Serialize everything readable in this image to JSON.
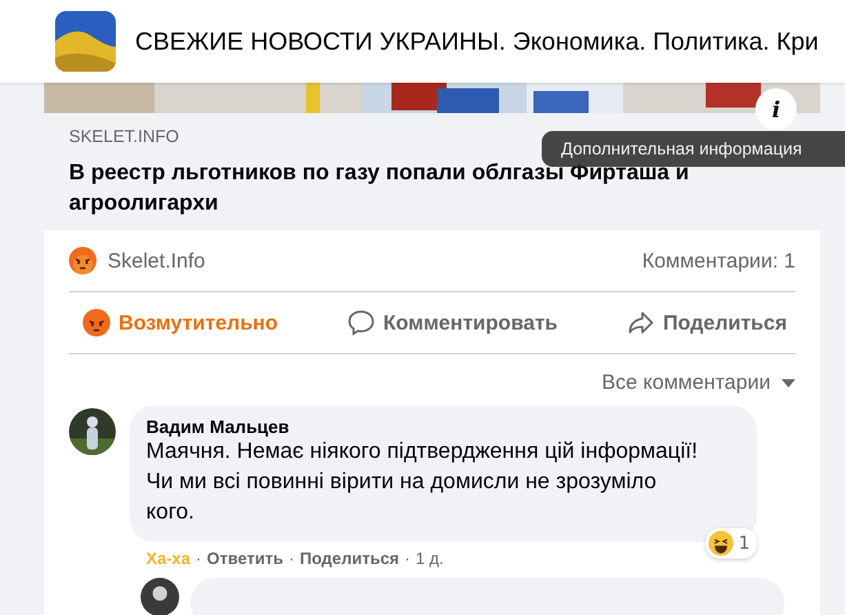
{
  "header": {
    "page_name": "СВЕЖИЕ НОВОСТИ УКРАИНЫ. Экономика. Политика. Кри"
  },
  "link_preview": {
    "info_button": "i",
    "domain": "SKELET.INFO",
    "title": "В реестр льготников по газу попали облгазы Фирташа и агроолигархи"
  },
  "tooltip": "Дополнительная информация",
  "reactions_summary": {
    "name": "Skelet.Info",
    "comments_count": "Комментарии: 1"
  },
  "actions": [
    {
      "kind": "react",
      "label": "Возмутительно",
      "selected": true
    },
    {
      "kind": "comment",
      "label": "Комментировать",
      "selected": false
    },
    {
      "kind": "share",
      "label": "Поделиться",
      "selected": false
    }
  ],
  "comment_filter": "Все комментарии",
  "comments": [
    {
      "author": "Вадим Мальцев",
      "text": "Маячня. Немає ніякого підтвердження цій інформації! Чи ми всі повинні вірити на домисли не зрозуміло кого.",
      "reaction_count": "1",
      "meta": [
        {
          "kind": "reaction",
          "text": "Ха-ха"
        },
        {
          "kind": "separator",
          "text": "·"
        },
        {
          "kind": "reply",
          "text": "Ответить"
        },
        {
          "kind": "separator",
          "text": "·"
        },
        {
          "kind": "share",
          "text": "Поделиться"
        },
        {
          "kind": "separator",
          "text": "·"
        },
        {
          "kind": "time",
          "text": "1 д."
        }
      ]
    }
  ]
}
